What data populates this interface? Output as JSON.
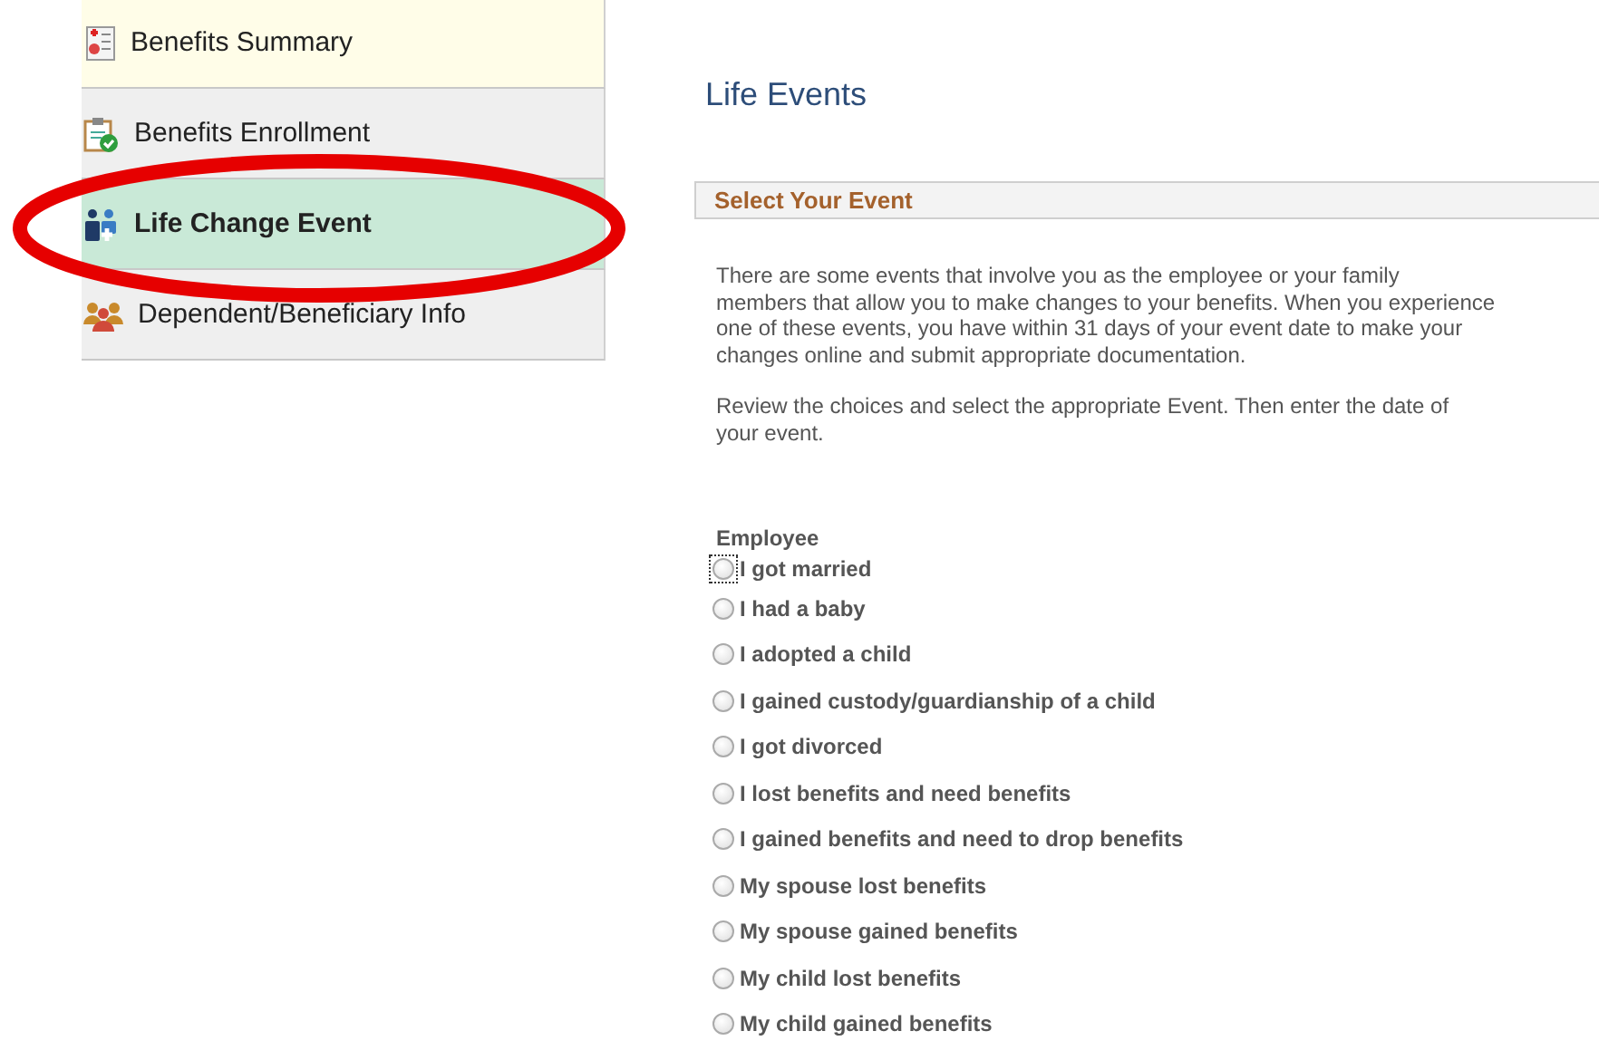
{
  "sidebar": {
    "items": [
      {
        "label": "Benefits Summary",
        "selected": false,
        "hovered": true
      },
      {
        "label": "Benefits Enrollment",
        "selected": false,
        "hovered": false
      },
      {
        "label": "Life Change Event",
        "selected": true,
        "hovered": false
      },
      {
        "label": "Dependent/Beneficiary Info",
        "selected": false,
        "hovered": false
      }
    ]
  },
  "annotation": {
    "kind": "ellipse",
    "color": "#e60000"
  },
  "page": {
    "title": "Life Events",
    "section_title": "Select Your Event",
    "paragraphs": [
      "There are some events that involve you as the employee or your family members that allow you to make changes to your benefits. When you experience one of these events, you have within 31 days of your event date to make your changes online and submit appropriate documentation.",
      "Review the choices and select the appropriate Event. Then enter the date of your event."
    ],
    "group_label": "Employee",
    "options": [
      {
        "label": "I got married",
        "selected": false,
        "focused": true
      },
      {
        "label": "I had a baby",
        "selected": false,
        "focused": false
      },
      {
        "label": "I adopted a child",
        "selected": false,
        "focused": false
      },
      {
        "label": "I gained custody/guardianship of a child",
        "selected": false,
        "focused": false
      },
      {
        "label": "I got divorced",
        "selected": false,
        "focused": false
      },
      {
        "label": "I lost benefits and need benefits",
        "selected": false,
        "focused": false
      },
      {
        "label": "I gained benefits and need to drop benefits",
        "selected": false,
        "focused": false
      },
      {
        "label": "My spouse lost benefits",
        "selected": false,
        "focused": false
      },
      {
        "label": "My spouse gained benefits",
        "selected": false,
        "focused": false
      },
      {
        "label": "My child lost benefits",
        "selected": false,
        "focused": false
      },
      {
        "label": "My child gained benefits",
        "selected": false,
        "focused": false
      }
    ]
  }
}
